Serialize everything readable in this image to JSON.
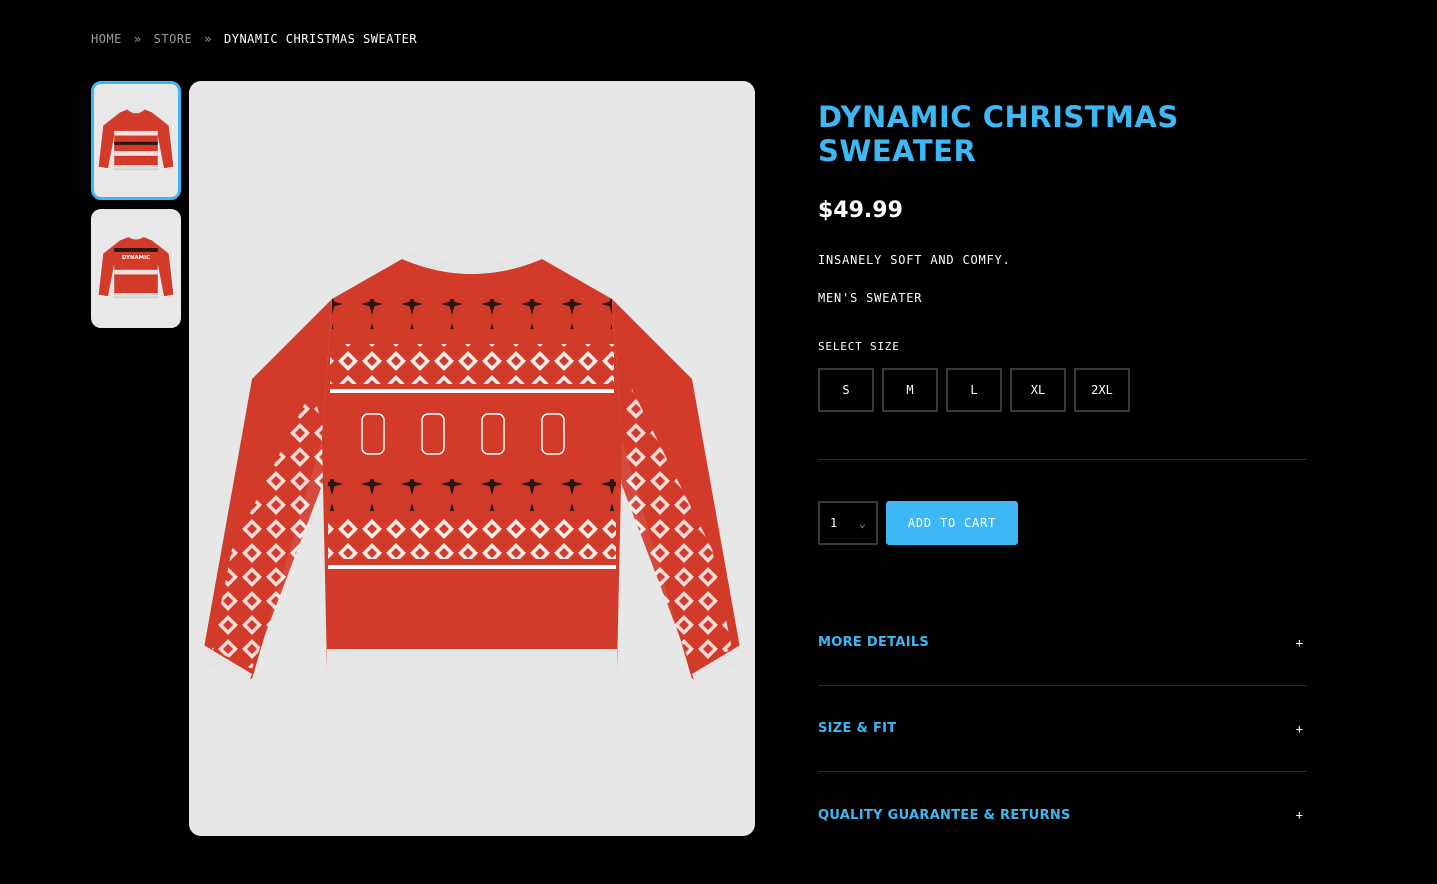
{
  "breadcrumb": {
    "items": [
      "HOME",
      "STORE",
      "DYNAMIC CHRISTMAS SWEATER"
    ],
    "separator": "»"
  },
  "product": {
    "title": "DYNAMIC CHRISTMAS SWEATER",
    "price": "$49.99",
    "description": "INSANELY SOFT AND COMFY.",
    "category": "MEN'S SWEATER",
    "size_label": "SELECT SIZE",
    "sizes": [
      "S",
      "M",
      "L",
      "XL",
      "2XL"
    ],
    "quantity": "1",
    "add_to_cart": "ADD TO CART",
    "thumb_wordmark": "DYNAMIC"
  },
  "accordion": [
    {
      "label": "MORE DETAILS",
      "icon": "+"
    },
    {
      "label": "SIZE & FIT",
      "icon": "+"
    },
    {
      "label": "QUALITY GUARANTEE & RETURNS",
      "icon": "+"
    }
  ],
  "colors": {
    "accent": "#3db8f5",
    "sweater_red": "#d23a2a",
    "sweater_dark": "#2a1612",
    "background": "#000000",
    "image_bg": "#e7e7e7"
  }
}
